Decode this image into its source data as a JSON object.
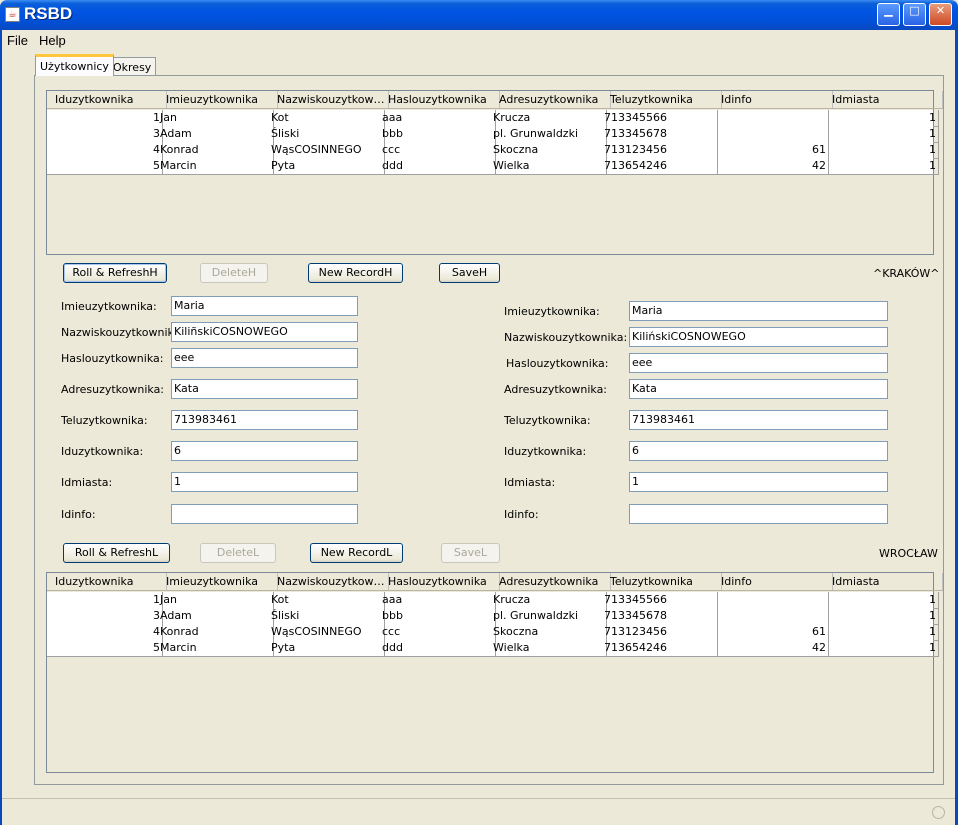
{
  "window": {
    "title": "RSBD"
  },
  "menu": [
    "File",
    "Help"
  ],
  "tabs": [
    "Użytkownicy",
    "Okresy"
  ],
  "columns": [
    "Iduzytkownika",
    "Imieuzytkownika",
    "Nazwiskouzytkow…",
    "Haslouzytkownika",
    "Adresuzytkownika",
    "Teluzytkownika",
    "Idinfo",
    "Idmiasta"
  ],
  "rows": [
    [
      "1",
      "Jan",
      "Kot",
      "aaa",
      "Krucza",
      "713345566",
      "",
      "1"
    ],
    [
      "3",
      "Adam",
      "Śliski",
      "bbb",
      "pl. Grunwaldzki",
      "713345678",
      "",
      "1"
    ],
    [
      "4",
      "Konrad",
      "WąsCOSINNEGO",
      "ccc",
      "Skoczna",
      "713123456",
      "61",
      "1"
    ],
    [
      "5",
      "Marcin",
      "Pyta",
      "ddd",
      "Wielka",
      "713654246",
      "42",
      "1"
    ]
  ],
  "top_buttons": {
    "roll": "Roll & RefreshH",
    "delete": "DeleteH",
    "new": "New RecordH",
    "save": "SaveH"
  },
  "bottom_buttons": {
    "roll": "Roll & RefreshL",
    "delete": "DeleteL",
    "new": "New RecordL",
    "save": "SaveL"
  },
  "city_top": "^KRAKÓW^",
  "city_bottom": "WROCŁAW",
  "form_labels": [
    "Imieuzytkownika:",
    "Nazwiskouzytkownika:",
    "Haslouzytkownika:",
    "Adresuzytkownika:",
    "Teluzytkownika:",
    "Iduzytkownika:",
    "Idmiasta:",
    "Idinfo:"
  ],
  "form_left": [
    "Maria",
    "KiliñskiCOSNOWEGO",
    "eee",
    "Kata",
    "713983461",
    "6",
    "1",
    ""
  ],
  "form_right": [
    "Maria",
    "KilińskiCOSNOWEGO",
    "eee",
    "Kata",
    "713983461",
    "6",
    "1",
    ""
  ]
}
